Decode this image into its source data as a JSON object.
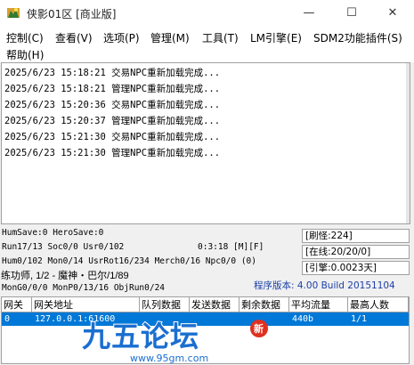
{
  "window": {
    "title": "侠影01区 [商业版]",
    "controls": {
      "minimize": "—",
      "maximize": "☐",
      "close": "✕"
    }
  },
  "menu": {
    "items": [
      "控制(C)",
      "查看(V)",
      "选项(P)",
      "管理(M)",
      "工具(T)",
      "LM引擎(E)",
      "SDM2功能插件(S)",
      "帮助(H)"
    ]
  },
  "log": {
    "lines": [
      "2025/6/23 15:18:21 交易NPC重新加载完成...",
      "2025/6/23 15:18:21 管理NPC重新加载完成...",
      "2025/6/23 15:20:36 交易NPC重新加载完成...",
      "2025/6/23 15:20:37 管理NPC重新加载完成...",
      "2025/6/23 15:21:30 交易NPC重新加载完成...",
      "2025/6/23 15:21:30 管理NPC重新加载完成..."
    ]
  },
  "status": {
    "humsave": "HumSave:0 HeroSave:0",
    "run": "Run17/13 Soc0/0 Usr0/102",
    "timer": "0:3:18 [M][F]",
    "hum": "Hum0/102 Mon0/14 UsrRot16/234 Merch0/16 Npc0/0 (0)",
    "practice": "练功师, 1/2 - 魔神・巴尔/1/89",
    "mongo": "MonG0/0/0 MonP0/13/16 ObjRun0/24",
    "refresh": "[刷怪:224]",
    "online": "[在线:20/20/0]",
    "engine": "[引擎:0.0023天]",
    "version": "程序版本: 4.00 Build 20151104"
  },
  "grid": {
    "headers": [
      "网关",
      "网关地址",
      "队列数据",
      "发送数据",
      "剩余数据",
      "平均流量",
      "最高人数"
    ],
    "rows": [
      {
        "gateway": "0",
        "address": "127.0.0.1:61600",
        "queue": "",
        "send": "",
        "remain": "",
        "avg": "440b",
        "max": "1/1"
      }
    ]
  },
  "watermark": {
    "logo_text": "九五论坛",
    "badge": "新",
    "url": "www.95gm.com"
  },
  "colors": {
    "selection": "#0078d7",
    "version_text": "#1a3fa8",
    "watermark": "#1a6fd0",
    "badge": "#e03020"
  }
}
